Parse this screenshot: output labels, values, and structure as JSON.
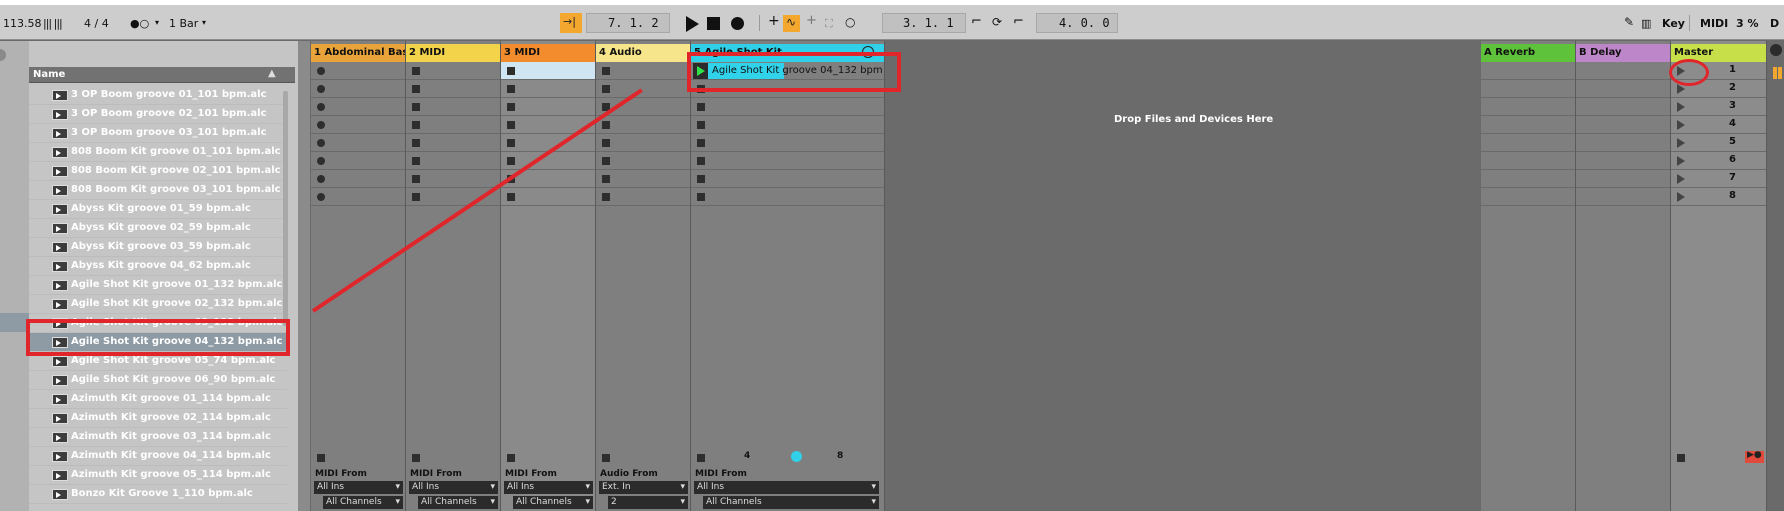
{
  "topbar": {
    "tempo": "113.58",
    "signature": "4 / 4",
    "metronome": "●○",
    "quantize": "1 Bar",
    "arrangement_position": "7.  1.  2",
    "loop_start": "3.  1.  1",
    "loop_length": "4.  0.  0",
    "key_label": "Key",
    "midi_label": "MIDI",
    "cpu_load": "3 %",
    "d_label": "D"
  },
  "browser": {
    "column_header": "Name",
    "items": [
      {
        "label": "3 OP Boom groove 01_101 bpm.alc"
      },
      {
        "label": "3 OP Boom groove 02_101 bpm.alc"
      },
      {
        "label": "3 OP Boom groove 03_101 bpm.alc"
      },
      {
        "label": "808 Boom Kit groove 01_101 bpm.alc"
      },
      {
        "label": "808 Boom Kit groove 02_101 bpm.alc"
      },
      {
        "label": "808 Boom Kit groove 03_101 bpm.alc"
      },
      {
        "label": "Abyss Kit groove 01_59 bpm.alc"
      },
      {
        "label": "Abyss Kit groove 02_59 bpm.alc"
      },
      {
        "label": "Abyss Kit groove 03_59 bpm.alc"
      },
      {
        "label": "Abyss Kit groove 04_62 bpm.alc"
      },
      {
        "label": "Agile Shot Kit groove 01_132 bpm.alc"
      },
      {
        "label": "Agile Shot Kit groove 02_132 bpm.alc"
      },
      {
        "label": "Agile Shot Kit groove 03_132 bpm.alc"
      },
      {
        "label": "Agile Shot Kit groove 04_132 bpm.alc",
        "selected": true
      },
      {
        "label": "Agile Shot Kit groove 05_74 bpm.alc"
      },
      {
        "label": "Agile Shot Kit groove 06_90 bpm.alc"
      },
      {
        "label": "Azimuth Kit groove 01_114 bpm.alc"
      },
      {
        "label": "Azimuth Kit groove 02_114 bpm.alc"
      },
      {
        "label": "Azimuth Kit groove 03_114 bpm.alc"
      },
      {
        "label": "Azimuth Kit groove 04_114 bpm.alc"
      },
      {
        "label": "Azimuth Kit groove 05_114 bpm.alc"
      },
      {
        "label": "Bonzo Kit Groove 1_110 bpm.alc"
      }
    ]
  },
  "tracks": [
    {
      "name": "1 Abdominal Bass",
      "color": "#e8a43a",
      "io_from": "MIDI From",
      "io_source": "All Ins",
      "io_channel": "All Channels"
    },
    {
      "name": "2 MIDI",
      "color": "#f3d34a",
      "io_from": "MIDI From",
      "io_source": "All Ins",
      "io_channel": "All Channels"
    },
    {
      "name": "3 MIDI",
      "color": "#f28c2c",
      "io_from": "MIDI From",
      "io_source": "All Ins",
      "io_channel": "All Channels"
    },
    {
      "name": "4 Audio",
      "color": "#f6e58a",
      "io_from": "Audio From",
      "io_source": "Ext. In",
      "io_channel": "2"
    },
    {
      "name": "5 Agile Shot Kit",
      "color": "#2fd0e8",
      "io_from": "MIDI From",
      "io_source": "All Ins",
      "io_channel": "All Channels"
    }
  ],
  "clip": {
    "label": "Agile Shot Kit groove 04_132 bpm",
    "color": "#30d3ea"
  },
  "track5_footer": {
    "a": "4",
    "b": "8"
  },
  "drop_zone": {
    "label": "Drop Files and Devices Here"
  },
  "returns": [
    {
      "name": "A Reverb",
      "color": "#5ec23a"
    },
    {
      "name": "B Delay",
      "color": "#bd86c9"
    }
  ],
  "master": {
    "name": "Master",
    "color": "#c7e04a",
    "scenes": [
      "1",
      "2",
      "3",
      "4",
      "5",
      "6",
      "7",
      "8"
    ]
  }
}
